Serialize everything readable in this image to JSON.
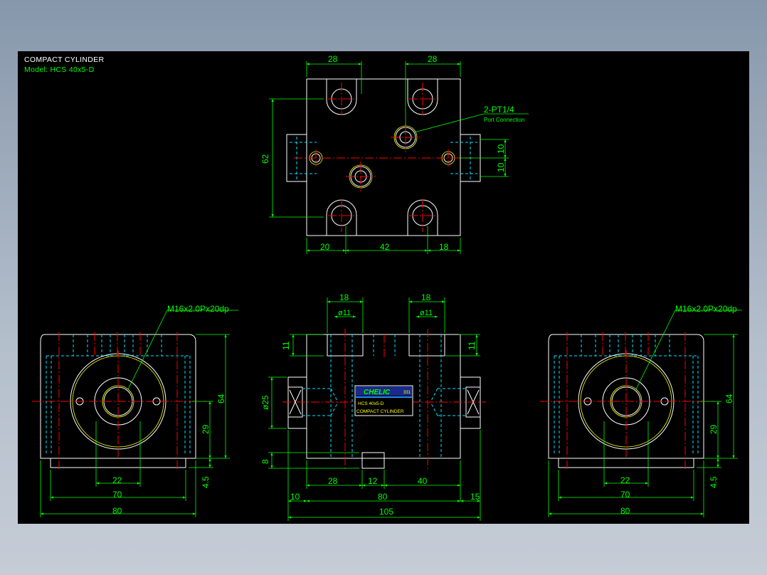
{
  "title_block": {
    "title": "COMPACT CYLINDER",
    "model": "Model: HCS 40x5-D"
  },
  "top_view": {
    "dim_left_28": "28",
    "dim_right_28": "28",
    "dim_height_62": "62",
    "dim_10_a": "10",
    "dim_10_b": "10",
    "dim_20": "20",
    "dim_42": "42",
    "dim_18": "18",
    "port_label": "2-PT1/4",
    "port_sub": "Port Connection"
  },
  "left_view": {
    "thread_label": "M16x2.0Px20dp",
    "dim_64": "64",
    "dim_29": "29",
    "dim_4_5": "4.5",
    "dim_22": "22",
    "dim_70": "70",
    "dim_80": "80"
  },
  "front_view": {
    "dim_18_a": "18",
    "dim_18_b": "18",
    "dia_11_a": "ø11",
    "dia_11_b": "ø11",
    "dim_11_a": "11",
    "dim_11_b": "11",
    "dia_25": "ø25",
    "dim_8": "8",
    "dim_28": "28",
    "dim_12": "12",
    "dim_40": "40",
    "dim_10": "10",
    "dim_80": "80",
    "dim_15": "15",
    "dim_105": "105",
    "label_brand": "CHELIC",
    "label_code": "331",
    "label_model": "HCS 40x5-D",
    "label_desc": "COMPACT CYLINDER"
  },
  "right_view": {
    "thread_label": "M16x2.0Px20dp",
    "dim_64": "64",
    "dim_29": "29",
    "dim_4_5": "4.5",
    "dim_22": "22",
    "dim_70": "70",
    "dim_80": "80"
  },
  "colors": {
    "background": "#000000",
    "outline": "#ffffff",
    "dimension": "#00ff00",
    "centerline": "#ff0000",
    "hidden": "#00e5ff",
    "highlight": "#ffff00",
    "label_bg": "#1a2a8a"
  }
}
